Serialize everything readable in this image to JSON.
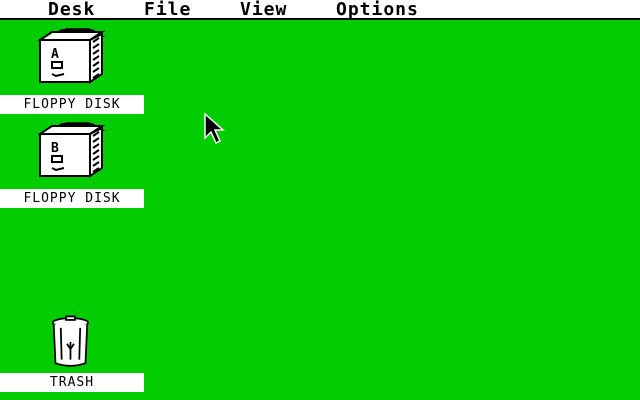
{
  "menubar": {
    "items": [
      {
        "label": "Desk"
      },
      {
        "label": "File"
      },
      {
        "label": "View"
      },
      {
        "label": "Options"
      }
    ]
  },
  "desktop": {
    "background": "#00cc00",
    "icons": [
      {
        "label": "FLOPPY DISK",
        "drive": "A",
        "icon": "floppy-drive-icon"
      },
      {
        "label": "FLOPPY DISK",
        "drive": "B",
        "icon": "floppy-drive-icon"
      },
      {
        "label": "TRASH",
        "icon": "trash-can-icon"
      }
    ]
  },
  "pointer": {
    "icon": "arrow-cursor-icon"
  }
}
